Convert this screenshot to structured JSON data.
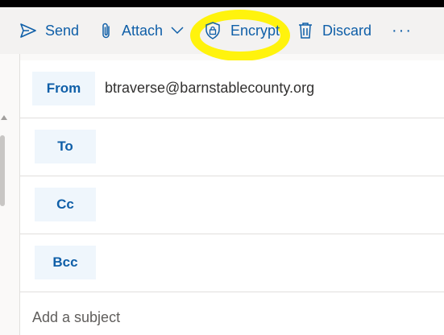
{
  "toolbar": {
    "send_label": "Send",
    "attach_label": "Attach",
    "encrypt_label": "Encrypt",
    "discard_label": "Discard",
    "more_label": "···",
    "icons": {
      "send": "send-icon",
      "attach": "paperclip-icon",
      "attach_dropdown": "chevron-down-icon",
      "encrypt": "shield-lock-icon",
      "discard": "trash-icon"
    }
  },
  "compose": {
    "from_label": "From",
    "from_value": "btraverse@barnstablecounty.org",
    "to_label": "To",
    "cc_label": "Cc",
    "bcc_label": "Bcc",
    "subject_placeholder": "Add a subject"
  },
  "colors": {
    "accent": "#0f5fa8",
    "highlight": "#fff200",
    "field_button_bg": "#eff6fc",
    "toolbar_bg": "#f3f2f1"
  }
}
